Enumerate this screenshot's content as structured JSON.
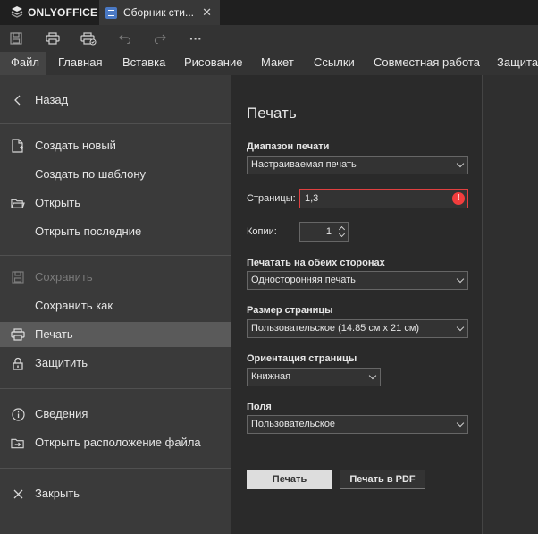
{
  "app": {
    "name": "ONLYOFFICE"
  },
  "document_tab": {
    "title": "Сборник сти..."
  },
  "quick_access": {
    "icons": [
      "save-icon",
      "print-icon",
      "quick-print-icon",
      "undo-icon",
      "redo-icon",
      "more-icon"
    ],
    "more_label": "···"
  },
  "menu": {
    "tabs": [
      {
        "label": "Файл",
        "active": true
      },
      {
        "label": "Главная"
      },
      {
        "label": "Вставка"
      },
      {
        "label": "Рисование"
      },
      {
        "label": "Макет"
      },
      {
        "label": "Ссылки"
      },
      {
        "label": "Совместная работа"
      },
      {
        "label": "Защита"
      }
    ]
  },
  "file_menu": {
    "back": "Назад",
    "create_new": "Создать новый",
    "create_template": "Создать по шаблону",
    "open": "Открыть",
    "open_recent": "Открыть последние",
    "save": "Сохранить",
    "save_as": "Сохранить как",
    "print": "Печать",
    "protect": "Защитить",
    "info": "Сведения",
    "open_location": "Открыть расположение файла",
    "close": "Закрыть"
  },
  "print_pane": {
    "title": "Печать",
    "range_label": "Диапазон печати",
    "range_value": "Настраиваемая печать",
    "pages_label": "Страницы:",
    "pages_value": "1,3",
    "pages_error_icon": "!",
    "copies_label": "Копии:",
    "copies_value": "1",
    "duplex_label": "Печатать на обеих сторонах",
    "duplex_value": "Односторонняя печать",
    "size_label": "Размер страницы",
    "size_value": "Пользовательское (14.85 см x 21 см)",
    "orientation_label": "Ориентация страницы",
    "orientation_value": "Книжная",
    "margins_label": "Поля",
    "margins_value": "Пользовательское",
    "print_button": "Печать",
    "pdf_button": "Печать в PDF"
  },
  "colors": {
    "error": "#f23d3d",
    "selected_item": "#5a5a5a",
    "doc_icon": "#4a79c4"
  }
}
